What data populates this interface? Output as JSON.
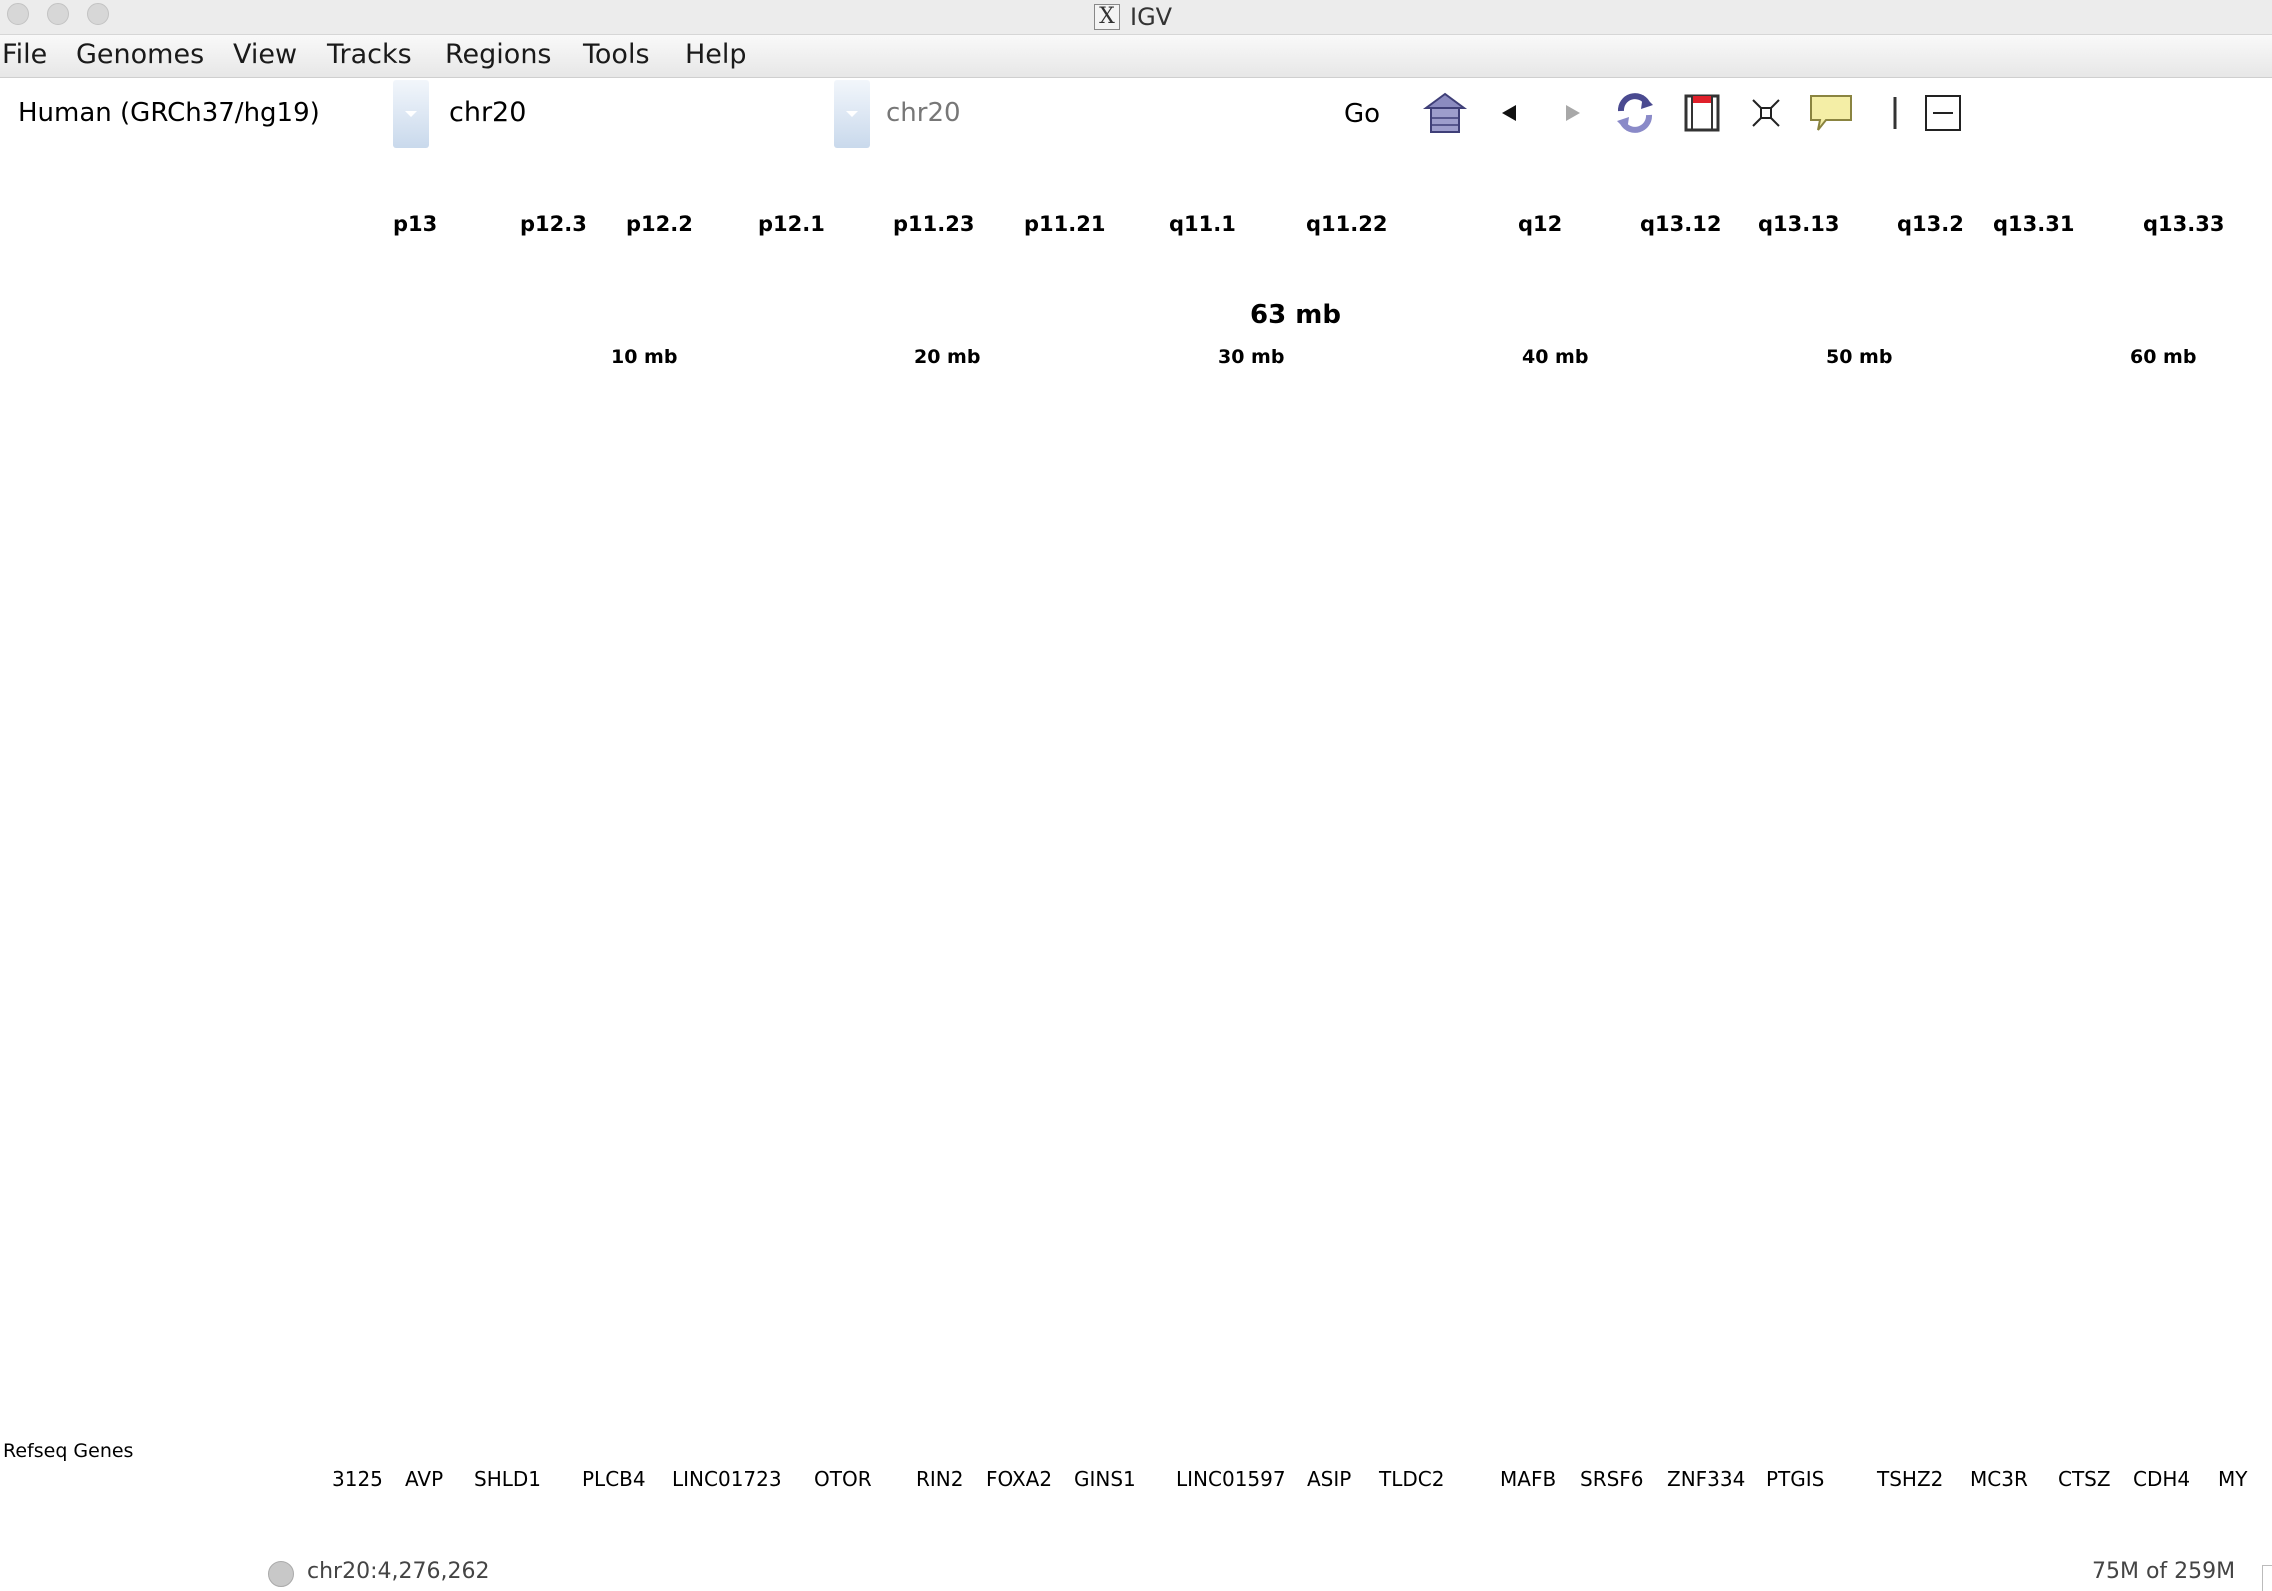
{
  "window": {
    "title": "IGV"
  },
  "menu": [
    "File",
    "Genomes",
    "View",
    "Tracks",
    "Regions",
    "Tools",
    "Help"
  ],
  "toolbar": {
    "genome": "Human (GRCh37/hg19)",
    "chromosome": "chr20",
    "locus": "chr20",
    "go_label": "Go",
    "icons": [
      "home-icon",
      "back-icon",
      "forward-icon",
      "refresh-icon",
      "region-of-interest-icon",
      "resize-to-window-icon",
      "popup-info-icon",
      "center-line-icon",
      "collapse-icon"
    ]
  },
  "ideogram": {
    "bands": [
      "p13",
      "p12.3",
      "p12.2",
      "p12.1",
      "p11.23",
      "p11.21",
      "q11.1",
      "q11.22",
      "q12",
      "q13.12",
      "q13.13",
      "q13.2",
      "q13.31",
      "q13.33"
    ]
  },
  "ruler": {
    "span": "63 mb",
    "ticks": [
      "10 mb",
      "20 mb",
      "30 mb",
      "40 mb",
      "50 mb",
      "60 mb"
    ]
  },
  "tracks": [
    {
      "name": "Refseq Genes",
      "genes": [
        "3125",
        "AVP",
        "SHLD1",
        "PLCB4",
        "LINC01723",
        "OTOR",
        "RIN2",
        "FOXA2",
        "GINS1",
        "LINC01597",
        "ASIP",
        "TLDC2",
        "MAFB",
        "SRSF6",
        "ZNF334",
        "PTGIS",
        "TSHZ2",
        "MC3R",
        "CTSZ",
        "CDH4",
        "MY"
      ]
    }
  ],
  "status": {
    "position": "chr20:4,276,262",
    "memory": "75M of 259M"
  }
}
